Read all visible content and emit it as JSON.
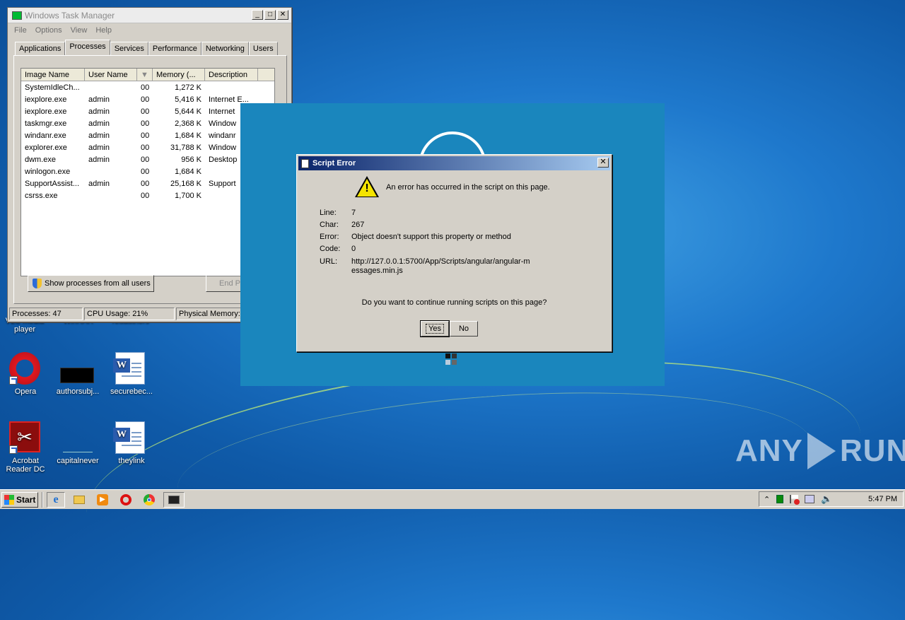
{
  "taskmanager": {
    "title": "Windows Task Manager",
    "menu": [
      "File",
      "Options",
      "View",
      "Help"
    ],
    "tabs": [
      "Applications",
      "Processes",
      "Services",
      "Performance",
      "Networking",
      "Users"
    ],
    "active_tab": "Processes",
    "columns": [
      "Image Name",
      "User Name",
      "",
      "Memory (...",
      "Description"
    ],
    "rows": [
      {
        "name": "SystemIdleCh...",
        "user": "",
        "cpu": "00",
        "mem": "1,272 K",
        "desc": ""
      },
      {
        "name": "iexplore.exe",
        "user": "admin",
        "cpu": "00",
        "mem": "5,416 K",
        "desc": "Internet E..."
      },
      {
        "name": "iexplore.exe",
        "user": "admin",
        "cpu": "00",
        "mem": "5,644 K",
        "desc": "Internet"
      },
      {
        "name": "taskmgr.exe",
        "user": "admin",
        "cpu": "00",
        "mem": "2,368 K",
        "desc": "Window"
      },
      {
        "name": "windanr.exe",
        "user": "admin",
        "cpu": "00",
        "mem": "1,684 K",
        "desc": "windanr"
      },
      {
        "name": "explorer.exe",
        "user": "admin",
        "cpu": "00",
        "mem": "31,788 K",
        "desc": "Window"
      },
      {
        "name": "dwm.exe",
        "user": "admin",
        "cpu": "00",
        "mem": "956 K",
        "desc": "Desktop"
      },
      {
        "name": "winlogon.exe",
        "user": "",
        "cpu": "00",
        "mem": "1,684 K",
        "desc": ""
      },
      {
        "name": "SupportAssist...",
        "user": "admin",
        "cpu": "00",
        "mem": "25,168 K",
        "desc": "Support"
      },
      {
        "name": "csrss.exe",
        "user": "",
        "cpu": "00",
        "mem": "1,700 K",
        "desc": ""
      }
    ],
    "show_all_label": "Show processes from all users",
    "end_process_label": "End Pr",
    "status": {
      "processes": "Processes: 47",
      "cpu": "CPU Usage: 21%",
      "memory": "Physical Memory:"
    }
  },
  "dialog": {
    "title": "Script Error",
    "message": "An error has occurred in the script on this page.",
    "line_label": "Line:",
    "line_value": "7",
    "char_label": "Char:",
    "char_value": "267",
    "error_label": "Error:",
    "error_value": "Object doesn't support this property or method",
    "code_label": "Code:",
    "code_value": "0",
    "url_label": "URL:",
    "url_value": "http://127.0.0.1:5700/App/Scripts/angular/angular-messages.min.js",
    "question": "Do you want to continue running scripts on this page?",
    "yes_label": "Yes",
    "no_label": "No"
  },
  "desktop": {
    "partial_labels": [
      "VLC media player",
      "WinRAR",
      "reuauthors"
    ],
    "icons": [
      {
        "label": "Opera",
        "icon": "opera-icon"
      },
      {
        "label": "authorsubj...",
        "icon": "black-file-icon"
      },
      {
        "label": "securebec...",
        "icon": "word-doc-icon"
      },
      {
        "label": "Acrobat Reader DC",
        "icon": "acrobat-icon"
      },
      {
        "label": "capitalnever",
        "icon": "blank-file-icon"
      },
      {
        "label": "theylink",
        "icon": "word-doc-icon"
      }
    ]
  },
  "taskbar": {
    "start_label": "Start",
    "clock": "5:47 PM",
    "tray_up": "⌃"
  },
  "watermark": {
    "left": "ANY",
    "right": "RUN"
  }
}
